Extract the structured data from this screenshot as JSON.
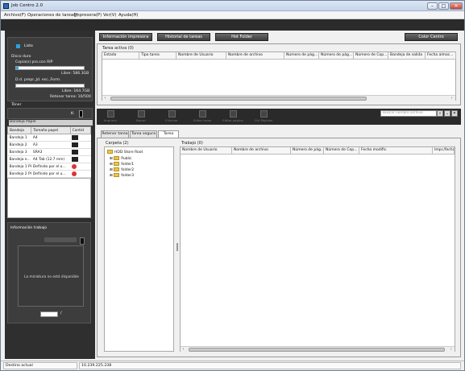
{
  "window": {
    "title": "Job Centro 2.0",
    "min": "–",
    "max": "□",
    "close": "✕"
  },
  "menu": [
    "Archivo(F)",
    "Operaciones de tarea(J)",
    "Impresora(P)",
    "Ver(V)",
    "Ayuda(H)"
  ],
  "left": {
    "status_label": "Listo",
    "disk_title": "Disco duro",
    "disk1_label": "Copia(s) pro.con RIP",
    "disk1_free": "Libre: 586.3GB",
    "disk2_label": "D.d. prepr.,Jd. esc.,Form.",
    "disk2_free": "Libre: 164.7GB",
    "retain": "Retener tarea: 10/500",
    "toner_title": "Tóner",
    "toner_k": "K:",
    "tray_title": "Bandeja Papel",
    "tray_headers": [
      "Bandeja",
      "Tamaño papel",
      "Cantid"
    ],
    "trays": [
      {
        "name": "Bandeja 1",
        "size": "A4",
        "color": "#222"
      },
      {
        "name": "Bandeja 2",
        "size": "A3",
        "color": "#222"
      },
      {
        "name": "Bandeja 3",
        "size": "SRA3",
        "color": "#222"
      },
      {
        "name": "Bandeja e...",
        "size": "A4 Tab (12.7 mm)",
        "color": "#222"
      },
      {
        "name": "Bandeja 1 PI",
        "size": "Definido por el u...",
        "color": "#d33"
      },
      {
        "name": "Bandeja 2 PI",
        "size": "Definido por el u...",
        "color": "#d33"
      }
    ],
    "jobinfo_title": "Información trabajo",
    "thumb_text": "La miniatura no está disponible",
    "page_sep": "/"
  },
  "top_buttons": [
    "Información impresora",
    "Historial de tareas",
    "Hot Folder",
    "Color Centro"
  ],
  "active": {
    "title": "Tarea activa (0)",
    "headers": [
      "Estado",
      "Tipo tarea",
      "Nombre de Usuario",
      "Nombre de archivo",
      "Número de pág...",
      "Número de pág...",
      "Número de Cop...",
      "Bandeja de salida",
      "Fecha almac..."
    ]
  },
  "toolbar": {
    "tools": [
      "Imprimir",
      "Borrar",
      "Eliminar",
      "Editar tarea",
      "Editar página",
      "Ctrl.Páginas"
    ],
    "search_placeholder": "Buscar nombre archivo",
    "search_icon": "⌕",
    "b2": "⌄",
    "b3": "✕"
  },
  "tabs": [
    "Retener tarea",
    "Tarea segura",
    "Tarea HDD"
  ],
  "folder": {
    "title": "Carpeta (2)",
    "root": "HDD Store Root",
    "items": [
      "Public",
      "folder1",
      "folder2",
      "folder3"
    ]
  },
  "jobs": {
    "title": "Trabajo (0)",
    "headers": [
      "Nombre de Usuario",
      "Nombre de archivo",
      "Número de pág...",
      "Número de Cop...",
      "Fecha modific.",
      "Impr./fecha"
    ]
  },
  "status": {
    "label": "Destino actual",
    "ip": "10.239.225.238"
  }
}
